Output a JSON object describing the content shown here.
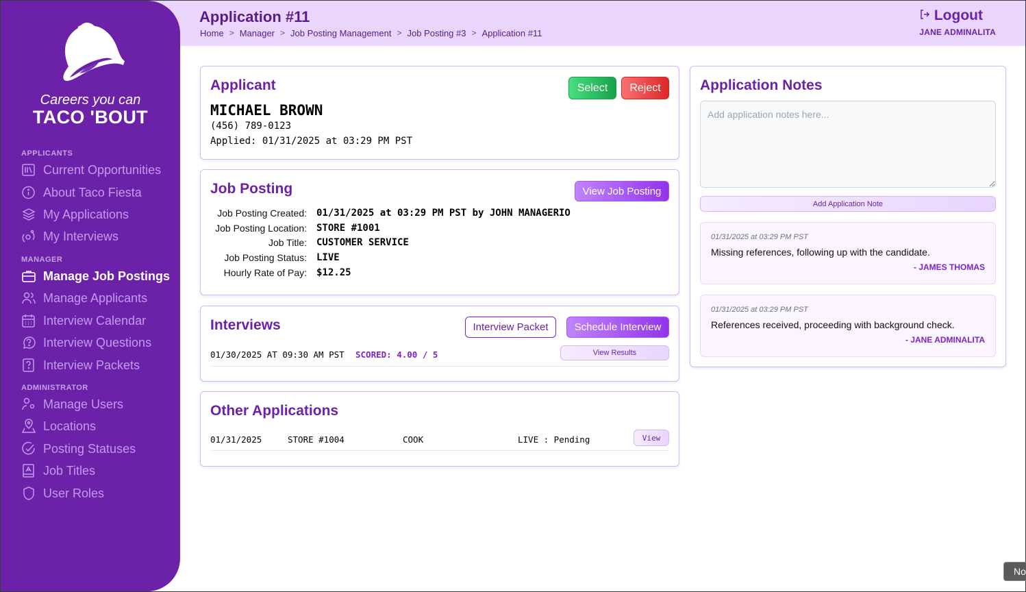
{
  "sidebar": {
    "tagline": "Careers you can",
    "brand": "TACO 'BOUT",
    "sections": [
      {
        "title": "APPLICANTS",
        "items": [
          {
            "label": "Current Opportunities",
            "icon": "library-icon"
          },
          {
            "label": "About Taco Fiesta",
            "icon": "info-icon"
          },
          {
            "label": "My Applications",
            "icon": "layers-icon"
          },
          {
            "label": "My Interviews",
            "icon": "interviews-icon"
          }
        ]
      },
      {
        "title": "MANAGER",
        "items": [
          {
            "label": "Manage Job Postings",
            "icon": "briefcase-icon",
            "active": true
          },
          {
            "label": "Manage Applicants",
            "icon": "users-icon"
          },
          {
            "label": "Interview Calendar",
            "icon": "calendar-icon"
          },
          {
            "label": "Interview Questions",
            "icon": "question-bubble-icon"
          },
          {
            "label": "Interview Packets",
            "icon": "question-file-icon"
          }
        ]
      },
      {
        "title": "ADMINISTRATOR",
        "items": [
          {
            "label": "Manage Users",
            "icon": "user-gear-icon"
          },
          {
            "label": "Locations",
            "icon": "location-user-icon"
          },
          {
            "label": "Posting Statuses",
            "icon": "check-circle-icon"
          },
          {
            "label": "Job Titles",
            "icon": "book-icon"
          },
          {
            "label": "User Roles",
            "icon": "shield-icon"
          }
        ]
      }
    ]
  },
  "header": {
    "title": "Application #11",
    "breadcrumb": [
      "Home",
      "Manager",
      "Job Posting Management",
      "Job Posting #3",
      "Application #11"
    ],
    "logout_label": "Logout",
    "user_name": "JANE ADMINALITA"
  },
  "applicant": {
    "title": "Applicant",
    "name": "MICHAEL BROWN",
    "phone": "(456) 789-0123",
    "applied": "Applied: 01/31/2025 at 03:29 PM PST",
    "select_label": "Select",
    "reject_label": "Reject"
  },
  "job_posting": {
    "title": "Job Posting",
    "view_label": "View Job Posting",
    "fields": [
      {
        "label": "Job Posting Created:",
        "value": "01/31/2025 at 03:29 PM PST by JOHN MANAGERIO"
      },
      {
        "label": "Job Posting Location:",
        "value": "STORE #1001"
      },
      {
        "label": "Job Title:",
        "value": "CUSTOMER SERVICE"
      },
      {
        "label": "Job Posting Status:",
        "value": "LIVE"
      },
      {
        "label": "Hourly Rate of Pay:",
        "value": "$12.25"
      }
    ]
  },
  "interviews": {
    "title": "Interviews",
    "packet_label": "Interview Packet",
    "schedule_label": "Schedule Interview",
    "items": [
      {
        "datetime": "01/30/2025 AT 09:30 AM PST",
        "score": "SCORED: 4.00 / 5",
        "results_label": "View Results"
      }
    ]
  },
  "other_applications": {
    "title": "Other Applications",
    "items": [
      {
        "date": "01/31/2025",
        "location": "STORE #1004",
        "job_title": "COOK",
        "status": "LIVE : Pending",
        "view_label": "View"
      }
    ]
  },
  "notes": {
    "title": "Application Notes",
    "placeholder": "Add application notes here...",
    "value": "",
    "add_label": "Add Application Note",
    "items": [
      {
        "time": "01/31/2025 at 03:29 PM PST",
        "text": "Missing references, following up with the candidate.",
        "author": "- JAMES THOMAS"
      },
      {
        "time": "01/31/2025 at 03:29 PM PST",
        "text": "References received, proceeding with background check.",
        "author": "- JANE ADMINALITA"
      }
    ]
  },
  "toast": {
    "text": "No"
  },
  "colors": {
    "brand_purple": "#6b21a8",
    "header_bg": "#ead5fc",
    "select_green": "#16a34a",
    "reject_red": "#dc2626"
  }
}
